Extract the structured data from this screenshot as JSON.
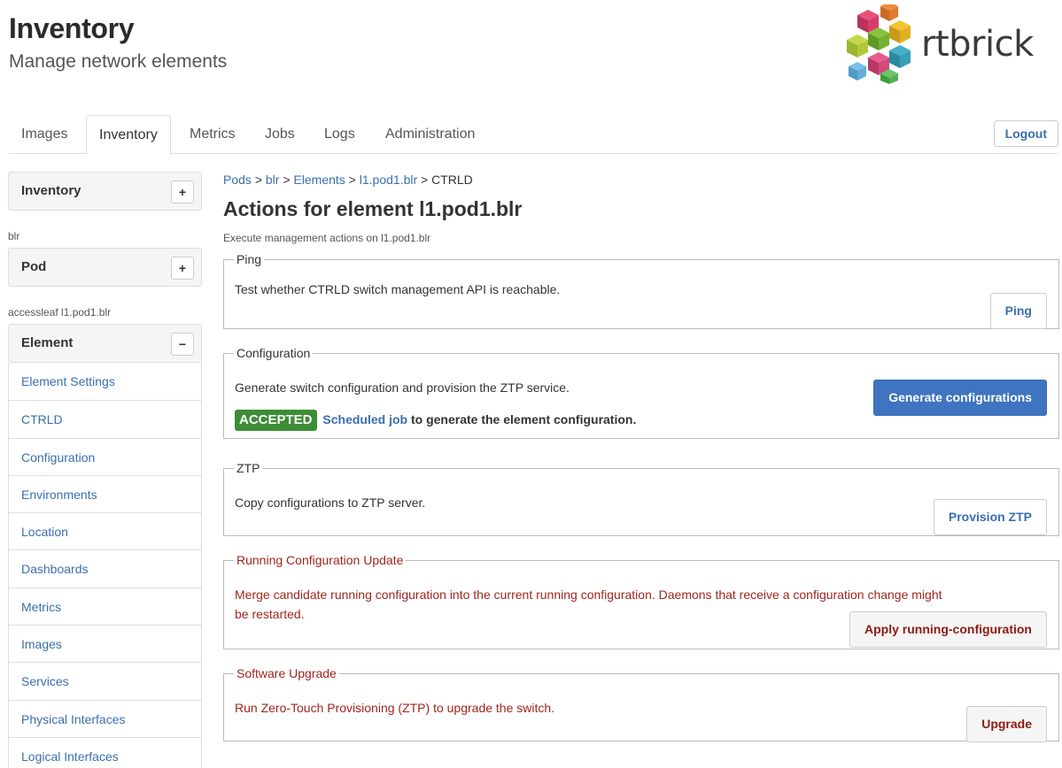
{
  "header": {
    "title": "Inventory",
    "subtitle": "Manage network elements",
    "logo_text": "rtbrick"
  },
  "tabs": [
    {
      "label": "Images",
      "active": false
    },
    {
      "label": "Inventory",
      "active": true
    },
    {
      "label": "Metrics",
      "active": false
    },
    {
      "label": "Jobs",
      "active": false
    },
    {
      "label": "Logs",
      "active": false
    },
    {
      "label": "Administration",
      "active": false
    }
  ],
  "logout_label": "Logout",
  "sidebar": {
    "inventory_panel": {
      "label": "Inventory",
      "toggle": "+"
    },
    "pod_caption": "blr",
    "pod_panel": {
      "label": "Pod",
      "toggle": "+"
    },
    "element_caption": "accessleaf l1.pod1.blr",
    "element_panel": {
      "label": "Element",
      "toggle": "−"
    },
    "items": [
      {
        "label": "Element Settings"
      },
      {
        "label": "CTRLD"
      },
      {
        "label": "Configuration"
      },
      {
        "label": "Environments"
      },
      {
        "label": "Location"
      },
      {
        "label": "Dashboards"
      },
      {
        "label": "Metrics"
      },
      {
        "label": "Images"
      },
      {
        "label": "Services"
      },
      {
        "label": "Physical Interfaces"
      },
      {
        "label": "Logical Interfaces"
      }
    ]
  },
  "breadcrumb": {
    "items": [
      "Pods",
      "blr",
      "Elements",
      "l1.pod1.blr"
    ],
    "current": "CTRLD",
    "separator": ">"
  },
  "main": {
    "title": "Actions for element l1.pod1.blr",
    "description": "Execute management actions on l1.pod1.blr"
  },
  "sections": {
    "ping": {
      "legend": "Ping",
      "text": "Test whether CTRLD switch management API is reachable.",
      "button": "Ping"
    },
    "configuration": {
      "legend": "Configuration",
      "text": "Generate switch configuration and provision the ZTP service.",
      "button": "Generate configurations",
      "status_badge": "ACCEPTED",
      "status_link": "Scheduled job",
      "status_text": "to generate the element configuration."
    },
    "ztp": {
      "legend": "ZTP",
      "text": "Copy configurations to ZTP server.",
      "button": "Provision ZTP"
    },
    "running_config": {
      "legend": "Running Configuration Update",
      "text_line1": "Merge candidate running configuration into the current running configuration. Daemons that receive a configuration change might",
      "text_line2": "be restarted.",
      "button": "Apply running-configuration"
    },
    "upgrade": {
      "legend": "Software Upgrade",
      "text": "Run Zero-Touch Provisioning (ZTP) to upgrade the switch.",
      "button": "Upgrade"
    }
  },
  "colors": {
    "link": "#3a6fb0",
    "primary_button": "#3f74c0",
    "danger": "#a0261e",
    "badge_success": "#3c8d35"
  }
}
